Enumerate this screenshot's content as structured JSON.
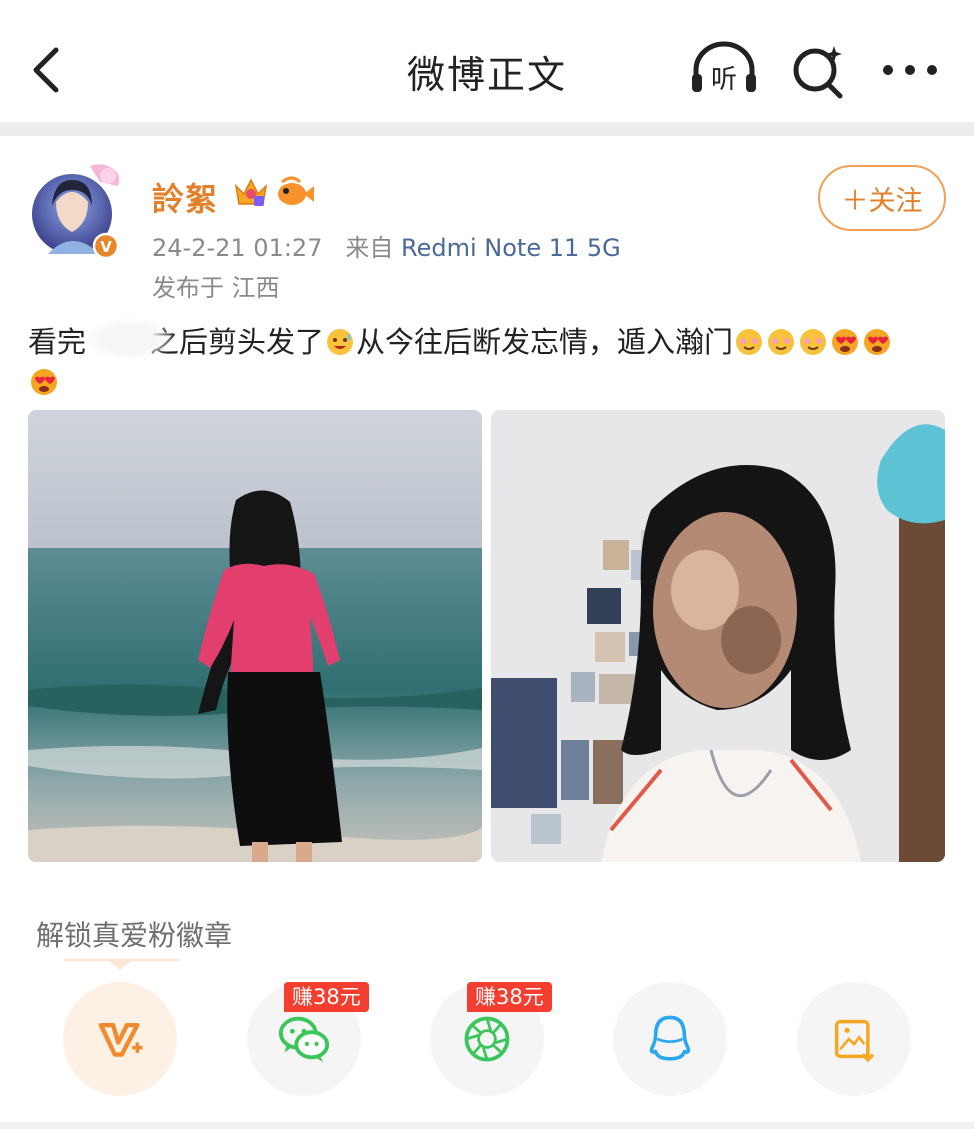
{
  "header": {
    "title": "微博正文",
    "listen_label": "听"
  },
  "post": {
    "author": "詅絮",
    "time": "24-2-21 01:27",
    "source_prefix": "来自",
    "device": "Redmi Note 11 5G",
    "location": "发布于 江西",
    "follow_label": "＋关注",
    "text_part1": "看完",
    "text_part2": "之后剪头发了",
    "text_part3": "从今往后断发忘情，遁入瀚门",
    "emoji_names": [
      "sweat-smile-emoji",
      "drool-emoji",
      "heart-eyes-emoji"
    ]
  },
  "unlock": {
    "label": "解锁真爱粉徽章"
  },
  "share": {
    "earn_wechat": "赚38元",
    "earn_moments": "赚38元",
    "buttons": [
      "vplus-icon",
      "wechat-icon",
      "moments-icon",
      "qq-icon",
      "save-image-icon"
    ]
  },
  "colors": {
    "accent": "#e3802a",
    "device_link": "#4a6a99",
    "earn_red": "#f43e2f",
    "wechat_green": "#3cc55a",
    "qq_blue": "#2aa7f0"
  }
}
